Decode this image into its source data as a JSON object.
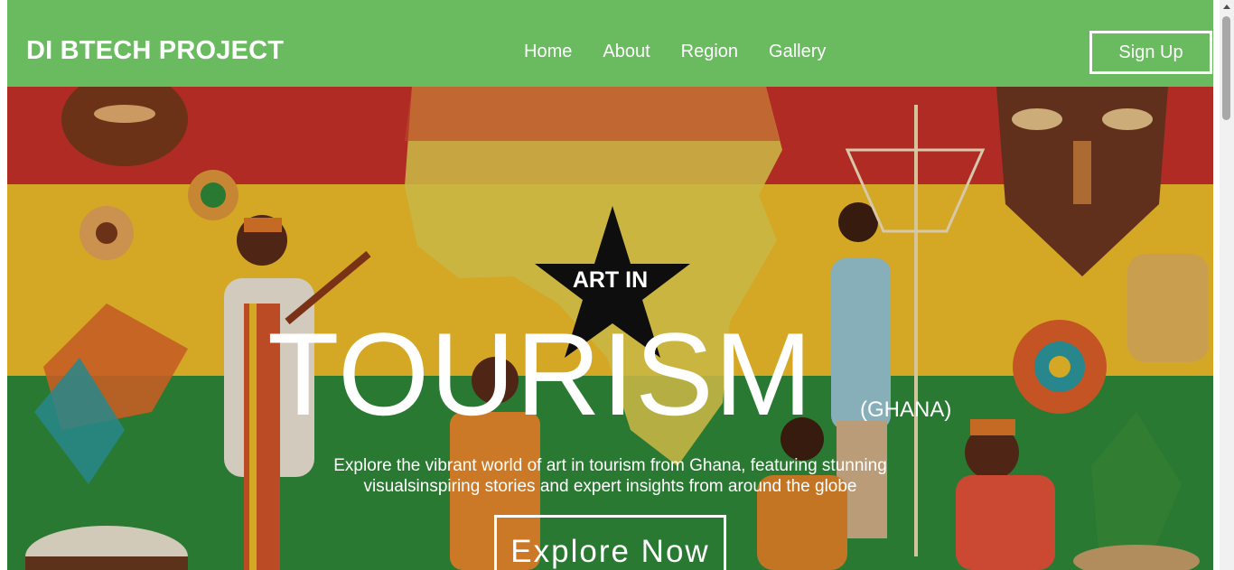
{
  "header": {
    "brand": "DI BTECH PROJECT",
    "nav": [
      "Home",
      "About",
      "Region",
      "Gallery"
    ],
    "signup_label": "Sign Up"
  },
  "hero": {
    "kicker": "ART IN",
    "headline": "TOURISM",
    "country": "(GHANA)",
    "description": "Explore the vibrant world of art in tourism from Ghana, featuring stunning visualsinspiring stories and expert insights from around the globe",
    "cta_label": "Explore Now",
    "background_image": "ghana-art-collage-image"
  },
  "colors": {
    "navbar": "#6abb60",
    "flag_red": "#c8312a",
    "flag_yellow": "#f2c02a",
    "flag_green": "#2f8a3a",
    "star": "#111111",
    "text": "#ffffff"
  }
}
